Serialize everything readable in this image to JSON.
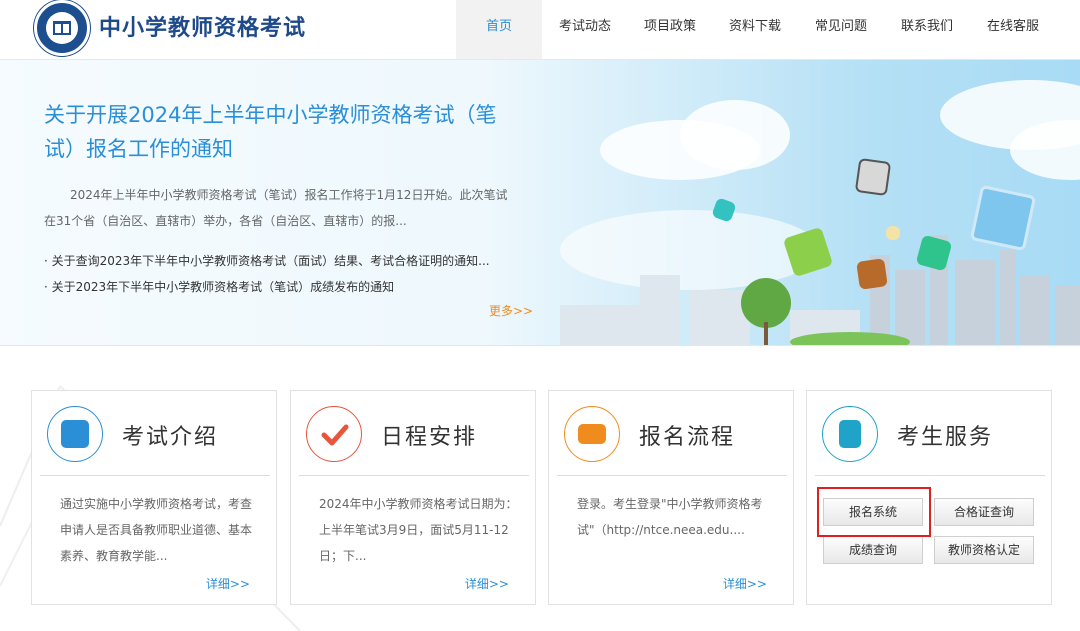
{
  "site": {
    "title": "中小学教师资格考试"
  },
  "nav": {
    "items": [
      {
        "label": "首页",
        "active": true
      },
      {
        "label": "考试动态",
        "active": false
      },
      {
        "label": "项目政策",
        "active": false
      },
      {
        "label": "资料下载",
        "active": false
      },
      {
        "label": "常见问题",
        "active": false
      },
      {
        "label": "联系我们",
        "active": false
      },
      {
        "label": "在线客服",
        "active": false
      }
    ]
  },
  "banner": {
    "title": "关于开展2024年上半年中小学教师资格考试（笔试）报名工作的通知",
    "description": "2024年上半年中小学教师资格考试（笔试）报名工作将于1月12日开始。此次笔试在31个省（自治区、直辖市）举办，各省（自治区、直辖市）的报...",
    "news": [
      "关于查询2023年下半年中小学教师资格考试（面试）结果、考试合格证明的通知...",
      "关于2023年下半年中小学教师资格考试（笔试）成绩发布的通知"
    ],
    "more_label": "更多>>"
  },
  "cards": [
    {
      "title": "考试介绍",
      "text": "通过实施中小学教师资格考试，考查申请人是否具备教师职业道德、基本素养、教育教学能...",
      "more_label": "详细>>",
      "icon": "document-edit-icon",
      "color": "#2a8fd6"
    },
    {
      "title": "日程安排",
      "text": "2024年中小学教师资格考试日期为：上半年笔试3月9日，面试5月11-12日；下...",
      "more_label": "详细>>",
      "icon": "checkmark-icon",
      "color": "#e8553c"
    },
    {
      "title": "报名流程",
      "text": "登录。考生登录\"中小学教师资格考试\"（http://ntce.neea.edu....",
      "more_label": "详细>>",
      "icon": "form-edit-icon",
      "color": "#f08c1e"
    },
    {
      "title": "考生服务",
      "icon": "id-card-icon",
      "color": "#1fa3c9",
      "buttons": [
        "报名系统",
        "合格证查询",
        "成绩查询",
        "教师资格认定"
      ]
    }
  ],
  "colors": {
    "accent": "#2a8fd6",
    "more_link": "#f08c1e",
    "highlight": "#e02020"
  }
}
